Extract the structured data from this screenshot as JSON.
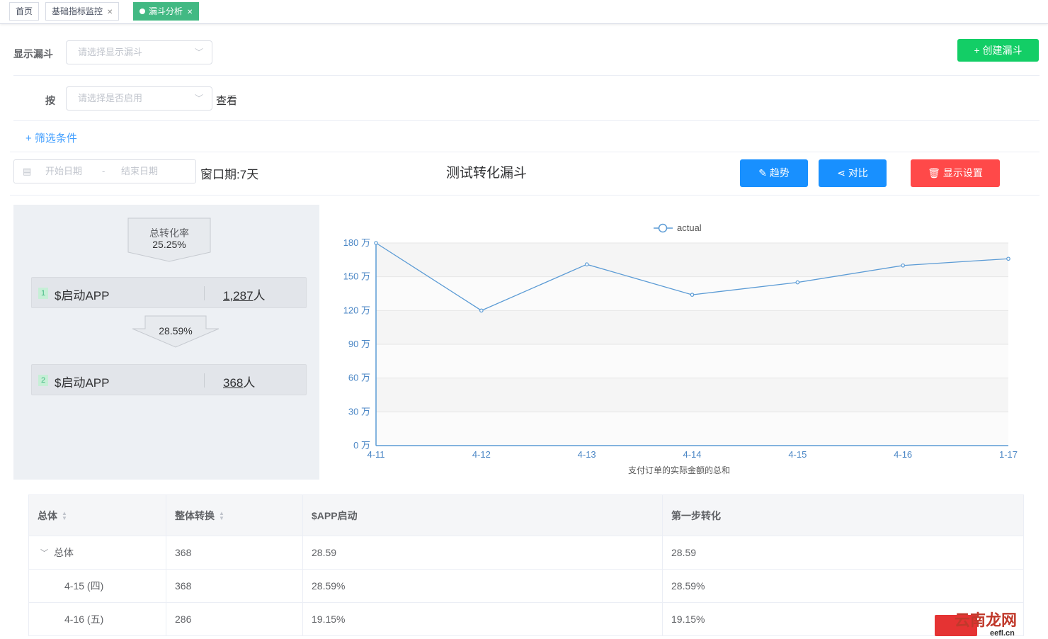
{
  "tabs": [
    {
      "label": "首页",
      "active": false,
      "closable": false
    },
    {
      "label": "基础指标监控",
      "active": false,
      "closable": true
    },
    {
      "label": "漏斗分析",
      "active": true,
      "closable": true
    }
  ],
  "filters": {
    "funnel_label": "显示漏斗",
    "funnel_placeholder": "请选择显示漏斗",
    "by_label": "按",
    "enable_placeholder": "请选择是否启用",
    "view_label": "查看",
    "add_filter": "+ 筛选条件",
    "create_button": "+ 创建漏斗"
  },
  "toolbar": {
    "start_placeholder": "开始日期",
    "range_sep": "-",
    "end_placeholder": "结束日期",
    "window_label": "窗口期:",
    "window_value": "7天",
    "chart_title": "测试转化漏斗",
    "trend_button": "趋势",
    "compare_button": "对比",
    "display_settings_button": "显示设置"
  },
  "funnel": {
    "total_label": "总转化率",
    "total_rate": "25.25%",
    "steps": [
      {
        "num": "1",
        "name": "$启动APP",
        "count": "1,287",
        "unit": "人"
      },
      {
        "num": "2",
        "name": "$启动APP",
        "count": "368",
        "unit": "人"
      }
    ],
    "step_rate": "28.59%"
  },
  "colors": {
    "accent_green": "#13ce66",
    "primary_blue": "#1890ff",
    "danger_red": "#ff4949",
    "line": "#5b9bd5",
    "tab_active": "#42b983"
  },
  "chart_data": {
    "type": "line",
    "categories": [
      "4-11",
      "4-12",
      "4-13",
      "4-14",
      "4-15",
      "4-16",
      "1-17"
    ],
    "series": [
      {
        "name": "actual",
        "values": [
          1800000,
          1200000,
          1610000,
          1340000,
          1450000,
          1600000,
          1660000
        ]
      }
    ],
    "yticks": [
      "0 万",
      "30 万",
      "60 万",
      "90 万",
      "120 万",
      "150 万",
      "180 万"
    ],
    "ylim": [
      0,
      1800000
    ],
    "xlabel": "支付订单的实际金额的总和",
    "legend": "top-center"
  },
  "table": {
    "headers": [
      "总体",
      "整体转换",
      "$APP启动",
      "第一步转化"
    ],
    "rows": [
      {
        "cells": [
          "总体",
          "368",
          "28.59",
          "28.59"
        ],
        "expandable": true
      },
      {
        "cells": [
          "4-15 (四)",
          "368",
          "28.59%",
          "28.59%"
        ],
        "expandable": false
      },
      {
        "cells": [
          "4-16 (五)",
          "286",
          "19.15%",
          "19.15%"
        ],
        "expandable": false
      }
    ]
  },
  "watermark": {
    "text": "云南龙网",
    "sub": "eefl.cn"
  }
}
